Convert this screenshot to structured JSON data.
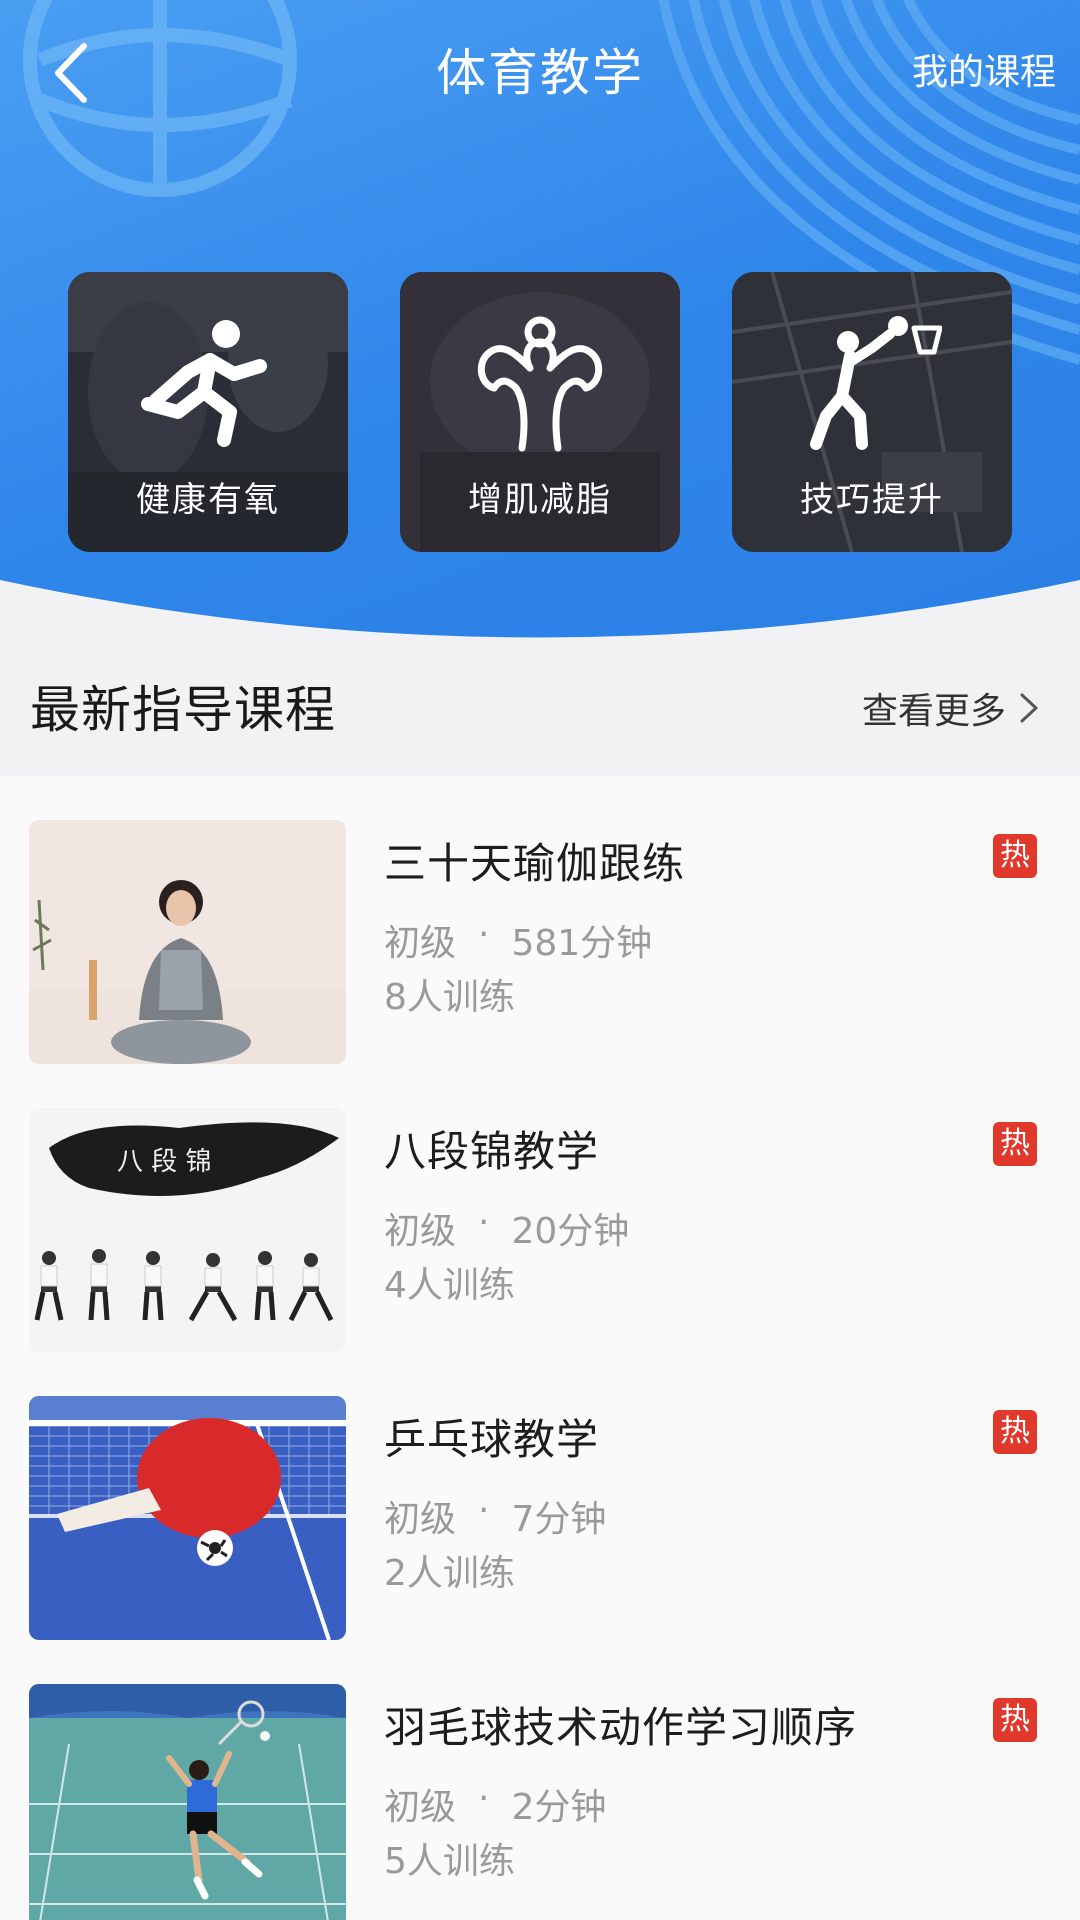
{
  "header": {
    "title": "体育教学",
    "right_link": "我的课程",
    "back_icon": "chevron-left-icon"
  },
  "categories": [
    {
      "label": "健康有氧",
      "icon": "running-person-icon"
    },
    {
      "label": "增肌减脂",
      "icon": "flexing-muscle-icon"
    },
    {
      "label": "技巧提升",
      "icon": "basketball-shot-icon"
    }
  ],
  "section": {
    "title": "最新指导课程",
    "see_more": "查看更多"
  },
  "courses": [
    {
      "title": "三十天瑜伽跟练",
      "level": "初级",
      "dot": "·",
      "duration": "581分钟",
      "trainees": "8人训练",
      "badge": "热"
    },
    {
      "title": "八段锦教学",
      "level": "初级",
      "dot": "·",
      "duration": "20分钟",
      "trainees": "4人训练",
      "badge": "热",
      "thumb_text": "八 段 锦"
    },
    {
      "title": "乒乓球教学",
      "level": "初级",
      "dot": "·",
      "duration": "7分钟",
      "trainees": "2人训练",
      "badge": "热"
    },
    {
      "title": "羽毛球技术动作学习顺序",
      "level": "初级",
      "dot": "·",
      "duration": "2分钟",
      "trainees": "5人训练",
      "badge": "热"
    }
  ],
  "colors": {
    "header_blue": "#2f86ea",
    "hot_red": "#e0392b"
  }
}
